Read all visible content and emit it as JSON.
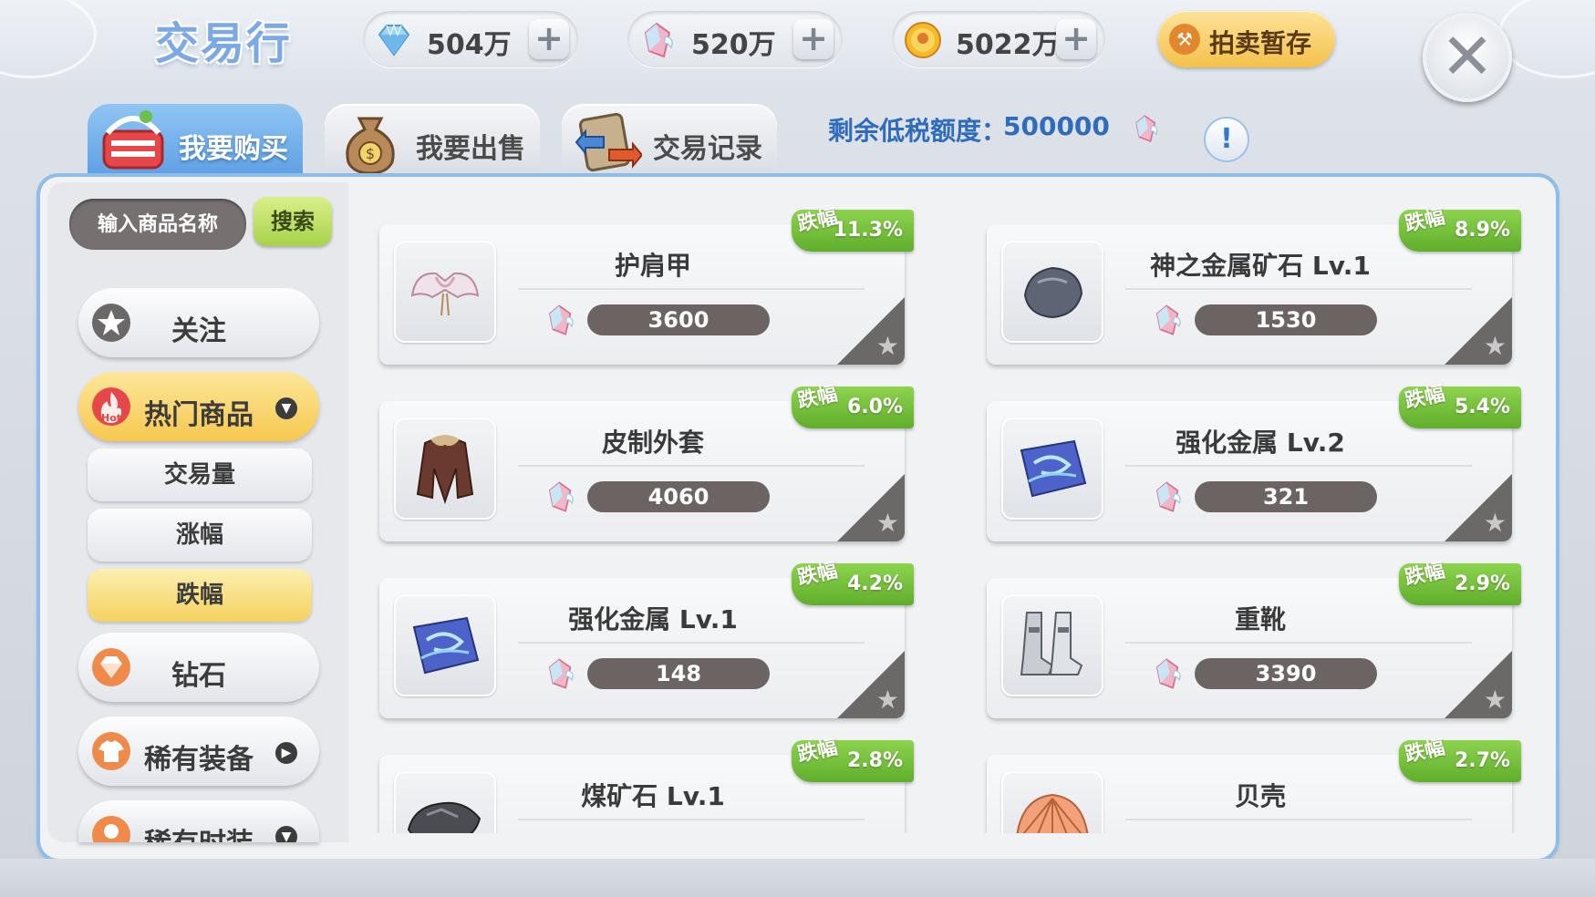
{
  "header": {
    "title": "交易行",
    "currencies": [
      {
        "icon": "diamond-icon",
        "value": "504万"
      },
      {
        "icon": "crystal-icon",
        "value": "520万"
      },
      {
        "icon": "gold-coin-icon",
        "value": "5022万"
      }
    ],
    "auction_label": "拍卖暂存"
  },
  "tabs": [
    {
      "label": "我要购买",
      "icon": "shopping-basket-icon",
      "active": true
    },
    {
      "label": "我要出售",
      "icon": "money-bag-icon",
      "active": false
    },
    {
      "label": "交易记录",
      "icon": "scroll-record-icon",
      "active": false
    }
  ],
  "tax": {
    "label": "剩余低税额度：",
    "value": "500000"
  },
  "search": {
    "placeholder": "输入商品名称",
    "button": "搜索"
  },
  "sidebar": {
    "favorite": "关注",
    "hot": "热门商品",
    "hot_icon_text": "Hot",
    "sub_items": [
      "交易量",
      "涨幅",
      "跌幅"
    ],
    "selected_sub": "跌幅",
    "diamond": "钻石",
    "rare_equipment": "稀有装备",
    "rare_fashion": "稀有时装"
  },
  "items": [
    {
      "name": "护肩甲",
      "price": "3600",
      "badge": "跌幅",
      "change": "11.3%"
    },
    {
      "name": "神之金属矿石 Lv.1",
      "price": "1530",
      "badge": "跌幅",
      "change": "8.9%"
    },
    {
      "name": "皮制外套",
      "price": "4060",
      "badge": "跌幅",
      "change": "6.0%"
    },
    {
      "name": "强化金属 Lv.2",
      "price": "321",
      "badge": "跌幅",
      "change": "5.4%"
    },
    {
      "name": "强化金属 Lv.1",
      "price": "148",
      "badge": "跌幅",
      "change": "4.2%"
    },
    {
      "name": "重靴",
      "price": "3390",
      "badge": "跌幅",
      "change": "2.9%"
    },
    {
      "name": "煤矿石 Lv.1",
      "price": "",
      "badge": "跌幅",
      "change": "2.8%"
    },
    {
      "name": "贝壳",
      "price": "",
      "badge": "跌幅",
      "change": "2.7%"
    }
  ],
  "colors": {
    "accent_blue": "#5d9fe3",
    "badge_green": "#6cbb35",
    "hot_yellow": "#f6c84f"
  }
}
